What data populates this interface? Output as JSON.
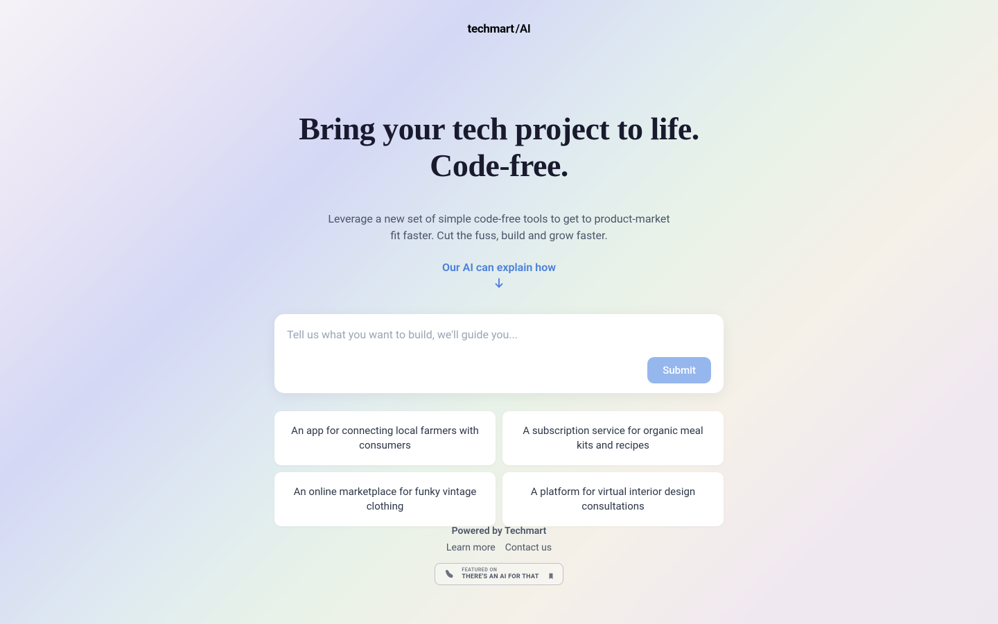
{
  "header": {
    "logo_main": "techmart",
    "logo_suffix": "/AI"
  },
  "hero": {
    "headline_line1": "Bring your tech project to life.",
    "headline_line2": "Code-free.",
    "subheadline": "Leverage a new set of simple code-free tools to get to product-market fit faster. Cut the fuss, build and grow faster.",
    "cta": "Our AI can explain how"
  },
  "input": {
    "placeholder": "Tell us what you want to build, we'll guide you...",
    "submit_label": "Submit"
  },
  "suggestions": [
    "An app for connecting local farmers with consumers",
    "A subscription service for organic meal kits and recipes",
    "An online marketplace for funky vintage clothing",
    "A platform for virtual interior design consultations"
  ],
  "footer": {
    "powered_by": "Powered by Techmart",
    "links": {
      "learn_more": "Learn more",
      "contact": "Contact us"
    },
    "badge": {
      "small": "FEATURED ON",
      "main": "THERE'S AN AI FOR THAT"
    }
  }
}
